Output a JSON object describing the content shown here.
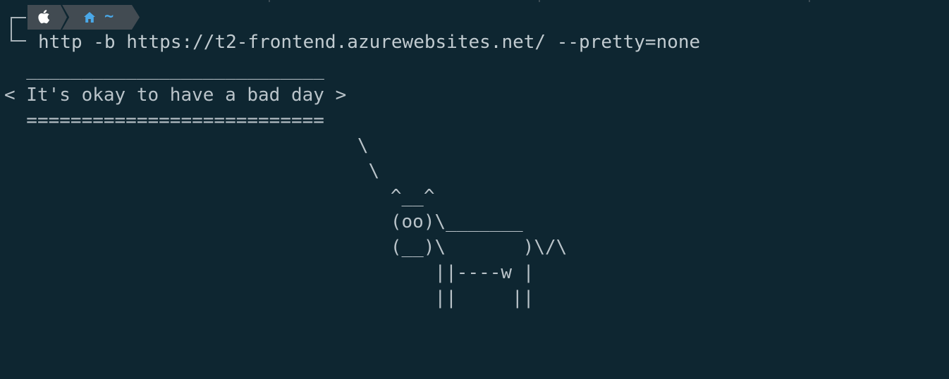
{
  "prompt": {
    "os_icon": "apple-icon",
    "dir_icon": "home-icon",
    "dir_label": "~",
    "command": "http -b https://t2-frontend.azurewebsites.net/ --pretty=none"
  },
  "output": {
    "lines": [
      "  ___________________________",
      "< It's okay to have a bad day >",
      "  ===========================",
      "                                \\",
      "                                 \\",
      "                                   ^__^",
      "                                   (oo)\\_______",
      "                                   (__)\\       )\\/\\",
      "                                       ||----w |",
      "                                       ||     ||"
    ]
  },
  "colors": {
    "background": "#0e2631",
    "segment": "#424b52",
    "accent": "#4aa8e8",
    "text": "#b9c3c9"
  }
}
